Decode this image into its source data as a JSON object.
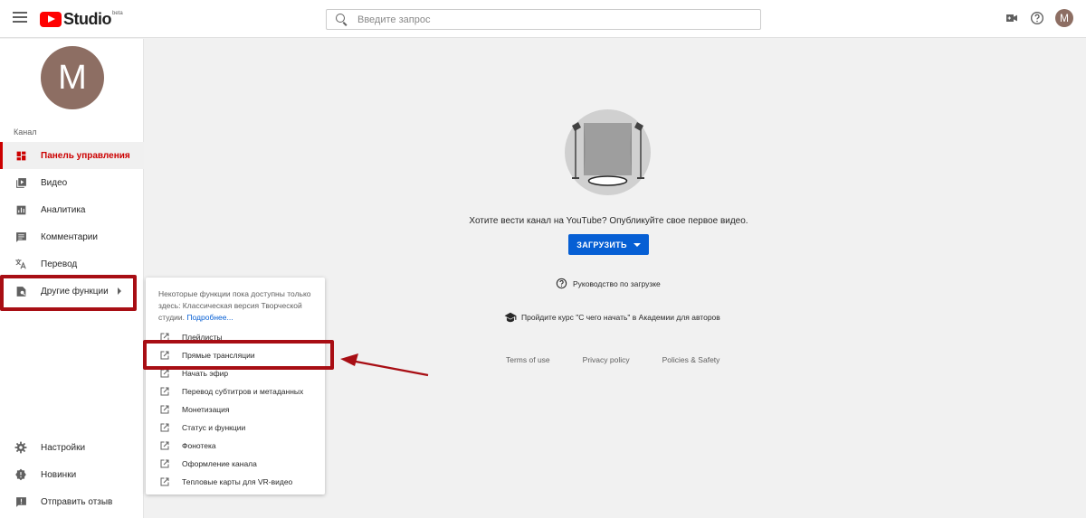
{
  "header": {
    "logo_text": "Studio",
    "logo_badge": "beta",
    "search_placeholder": "Введите запрос",
    "avatar_letter": "M"
  },
  "sidebar": {
    "avatar_letter": "M",
    "section_label": "Канал",
    "items": [
      {
        "label": "Панель управления",
        "icon": "dashboard-icon",
        "active": true
      },
      {
        "label": "Видео",
        "icon": "video-icon"
      },
      {
        "label": "Аналитика",
        "icon": "analytics-icon"
      },
      {
        "label": "Комментарии",
        "icon": "comments-icon"
      },
      {
        "label": "Перевод",
        "icon": "translate-icon"
      },
      {
        "label": "Другие функции",
        "icon": "other-features-icon"
      }
    ],
    "bottom_items": [
      {
        "label": "Настройки",
        "icon": "gear-icon"
      },
      {
        "label": "Новинки",
        "icon": "whats-new-icon"
      },
      {
        "label": "Отправить отзыв",
        "icon": "feedback-icon"
      }
    ]
  },
  "flyout": {
    "note": "Некоторые функции пока доступны только здесь: Классическая версия Творческой студии.",
    "note_link": "Подробнее...",
    "items": [
      "Плейлисты",
      "Прямые трансляции",
      "Начать эфир",
      "Перевод субтитров и метаданных",
      "Монетизация",
      "Статус и функции",
      "Фонотека",
      "Оформление канала",
      "Тепловые карты для VR-видео"
    ]
  },
  "main": {
    "empty_text": "Хотите вести канал на YouTube? Опубликуйте свое первое видео.",
    "upload_label": "ЗАГРУЗИТЬ",
    "guide_label": "Руководство по загрузке",
    "academy_label": "Пройдите курс \"С чего начать\" в Академии для авторов",
    "footer": [
      "Terms of use",
      "Privacy policy",
      "Policies & Safety"
    ]
  },
  "colors": {
    "accent_red": "#cc0000",
    "upload_blue": "#065fd4",
    "annotation_red": "#a80e14",
    "avatar": "#8d6e63"
  }
}
